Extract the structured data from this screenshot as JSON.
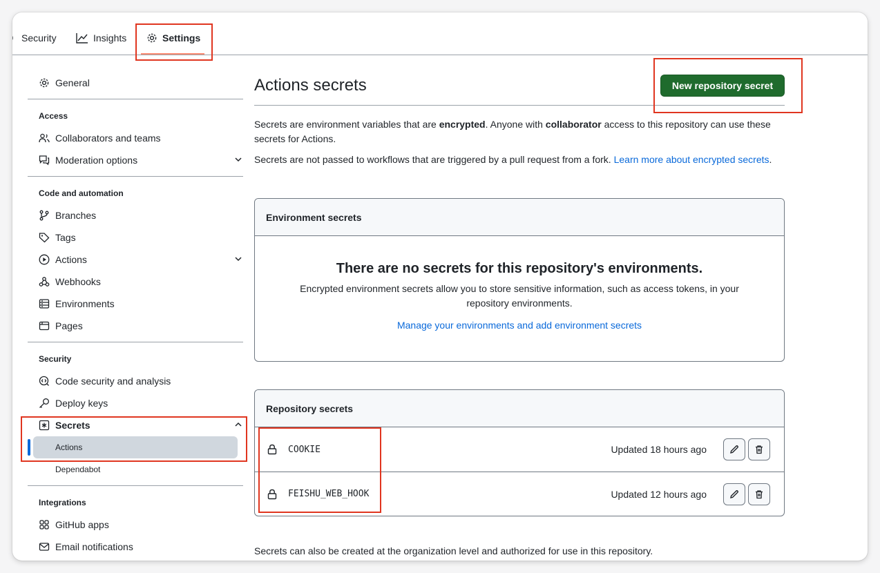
{
  "topnav": {
    "tabs": [
      {
        "label": "Security",
        "icon": "shield-icon"
      },
      {
        "label": "Insights",
        "icon": "graph-icon"
      },
      {
        "label": "Settings",
        "icon": "gear-icon",
        "selected": true
      }
    ]
  },
  "sidebar": {
    "general": "General",
    "sections": [
      {
        "heading": "Access",
        "items": [
          "Collaborators and teams",
          "Moderation options"
        ]
      },
      {
        "heading": "Code and automation",
        "items": [
          "Branches",
          "Tags",
          "Actions",
          "Webhooks",
          "Environments",
          "Pages"
        ]
      },
      {
        "heading": "Security",
        "items": [
          "Code security and analysis",
          "Deploy keys",
          "Secrets"
        ],
        "subitems": [
          "Actions",
          "Dependabot"
        ]
      },
      {
        "heading": "Integrations",
        "items": [
          "GitHub apps",
          "Email notifications"
        ]
      }
    ]
  },
  "main": {
    "title": "Actions secrets",
    "new_button": "New repository secret",
    "intro": {
      "p1_a": "Secrets are environment variables that are ",
      "p1_b": "encrypted",
      "p1_c": ". Anyone with ",
      "p1_d": "collaborator",
      "p1_e": " access to this repository can use these secrets for Actions.",
      "p2_a": "Secrets are not passed to workflows that are triggered by a pull request from a fork. ",
      "p2_link": "Learn more about encrypted secrets",
      "p2_end": "."
    },
    "env_secrets": {
      "header": "Environment secrets",
      "empty_title": "There are no secrets for this repository's environments.",
      "empty_desc": "Encrypted environment secrets allow you to store sensitive information, such as access tokens, in your repository environments.",
      "link": "Manage your environments and add environment secrets"
    },
    "repo_secrets": {
      "header": "Repository secrets",
      "rows": [
        {
          "name": "COOKIE",
          "updated": "Updated 18 hours ago"
        },
        {
          "name": "FEISHU_WEB_HOOK",
          "updated": "Updated 12 hours ago"
        }
      ]
    },
    "footer_note": "Secrets can also be created at the organization level and authorized for use in this repository."
  },
  "colors": {
    "primary_button": "#1f6b2d",
    "link": "#0969da",
    "highlight_box": "#e0351f",
    "active_indicator": "#0969da"
  }
}
